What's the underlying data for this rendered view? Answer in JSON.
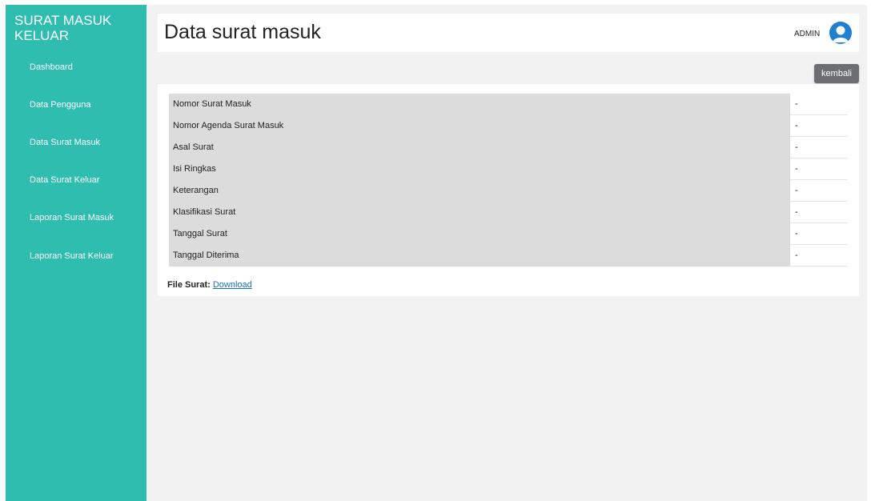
{
  "sidebar": {
    "brand": "SURAT MASUK KELUAR",
    "items": [
      {
        "label": "Dashboard"
      },
      {
        "label": "Data Pengguna"
      },
      {
        "label": "Data Surat Masuk"
      },
      {
        "label": "Data Surat Keluar"
      },
      {
        "label": "Laporan Surat Masuk"
      },
      {
        "label": "Laporan Surat Keluar"
      }
    ]
  },
  "header": {
    "title": "Data surat masuk",
    "user_label": "ADMIN"
  },
  "actions": {
    "back_label": "kembali"
  },
  "details": {
    "rows": [
      {
        "label": "Nomor Surat Masuk",
        "value": "-"
      },
      {
        "label": "Nomor Agenda Surat Masuk",
        "value": "-"
      },
      {
        "label": "Asal Surat",
        "value": "-"
      },
      {
        "label": "Isi Ringkas",
        "value": "-"
      },
      {
        "label": "Keterangan",
        "value": "-"
      },
      {
        "label": "Klasifikasi Surat",
        "value": "-"
      },
      {
        "label": "Tanggal Surat",
        "value": "-"
      },
      {
        "label": "Tanggal Diterima",
        "value": "-"
      }
    ],
    "file_label": "File Surat:",
    "file_link": "Download"
  },
  "colors": {
    "sidebar": "#2ebdaf",
    "page_background": "#f2f2f2",
    "label_cell": "#dcdcdc",
    "back_button": "#6b6f73",
    "link": "#1a6fc9",
    "avatar": "#1f7fd1"
  },
  "icons": {
    "avatar": "user-avatar-icon"
  }
}
